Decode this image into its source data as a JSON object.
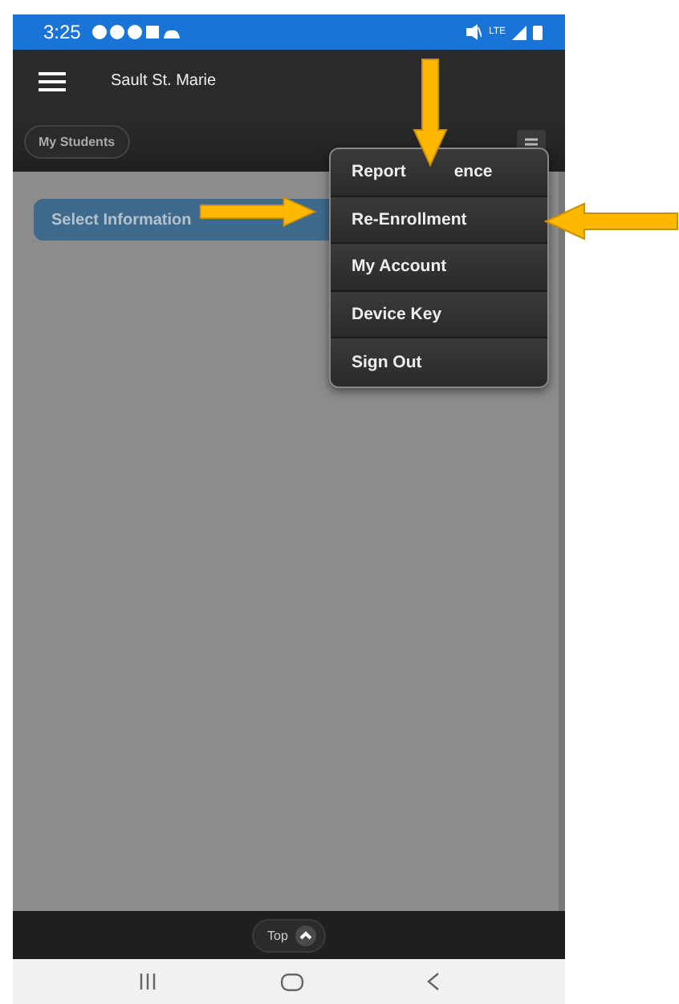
{
  "status_bar": {
    "time": "3:25",
    "network": "LTE"
  },
  "header": {
    "title": "Sault St. Marie"
  },
  "toolbar": {
    "button": "My Students"
  },
  "content": {
    "select_label": "Select Information"
  },
  "menu": {
    "items": [
      {
        "label": "Report",
        "label_tail": "ence"
      },
      {
        "label": "Re-Enrollment"
      },
      {
        "label": "My Account"
      },
      {
        "label": "Device Key"
      },
      {
        "label": "Sign Out"
      }
    ]
  },
  "footer": {
    "top_button": "Top"
  }
}
